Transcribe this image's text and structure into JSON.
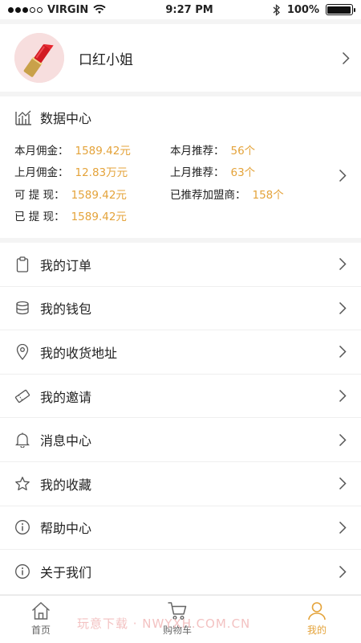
{
  "status_bar": {
    "carrier": "VIRGIN",
    "time": "9:27 PM",
    "battery": "100%",
    "battery_level": 1.0
  },
  "profile": {
    "name": "口红小姐"
  },
  "data_center": {
    "title": "数据中心",
    "rows": [
      {
        "label": "本月佣金：",
        "value": "1589.42元"
      },
      {
        "label": "上月佣金：",
        "value": "12.83万元"
      },
      {
        "label": "可 提 现：",
        "value": "1589.42元"
      },
      {
        "label": "已 提 现：",
        "value": "1589.42元"
      }
    ],
    "right_rows": [
      {
        "label": "本月推荐：",
        "value": "56个"
      },
      {
        "label": "上月推荐：",
        "value": "63个"
      },
      {
        "label": "已推荐加盟商：",
        "value": "158个"
      }
    ]
  },
  "menu": [
    {
      "label": "我的订单",
      "icon": "clipboard-icon"
    },
    {
      "label": "我的钱包",
      "icon": "wallet-icon"
    },
    {
      "label": "我的收货地址",
      "icon": "location-icon"
    },
    {
      "label": "我的邀请",
      "icon": "ticket-icon"
    },
    {
      "label": "消息中心",
      "icon": "bell-icon"
    },
    {
      "label": "我的收藏",
      "icon": "star-icon"
    },
    {
      "label": "帮助中心",
      "icon": "info-icon"
    },
    {
      "label": "关于我们",
      "icon": "about-icon"
    }
  ],
  "tabs": [
    {
      "label": "首页",
      "icon": "home-icon"
    },
    {
      "label": "购物车",
      "icon": "cart-icon"
    },
    {
      "label": "我的",
      "icon": "user-icon"
    }
  ],
  "active_tab": "我的",
  "watermark": "玩意下载 · NWYXH.COM.CN",
  "colors": {
    "accent": "#e4a33a",
    "background": "#f4f4f4",
    "card": "#ffffff"
  }
}
